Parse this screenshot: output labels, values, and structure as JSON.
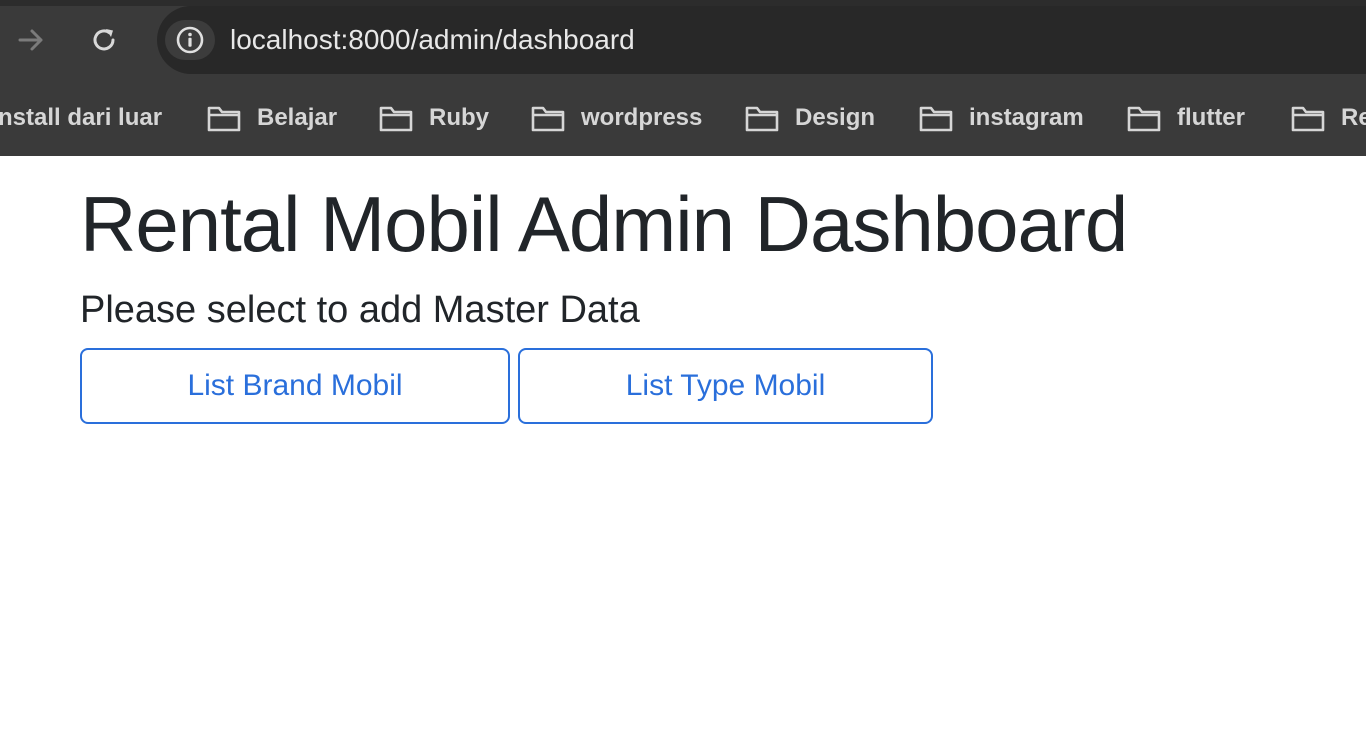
{
  "browser": {
    "url": "localhost:8000/admin/dashboard",
    "icons": {
      "forward": "arrow-right-icon",
      "reload": "reload-icon",
      "site_info": "info-icon",
      "bookmark_folder": "folder-icon"
    },
    "bookmarks": [
      {
        "label": "nstall dari luar",
        "has_folder_icon": false
      },
      {
        "label": "Belajar",
        "has_folder_icon": true
      },
      {
        "label": "Ruby",
        "has_folder_icon": true
      },
      {
        "label": "wordpress",
        "has_folder_icon": true
      },
      {
        "label": "Design",
        "has_folder_icon": true
      },
      {
        "label": "instagram",
        "has_folder_icon": true
      },
      {
        "label": "flutter",
        "has_folder_icon": true
      },
      {
        "label": "Re",
        "has_folder_icon": true
      }
    ]
  },
  "page": {
    "title": "Rental Mobil Admin Dashboard",
    "subtitle": "Please select to add Master Data",
    "buttons": {
      "brand_label": "List Brand Mobil",
      "type_label": "List Type Mobil"
    }
  },
  "colors": {
    "chrome_bg": "#3a3a3a",
    "omnibox_bg": "#282828",
    "primary": "#2a6fdb",
    "heading_text": "#212529"
  }
}
